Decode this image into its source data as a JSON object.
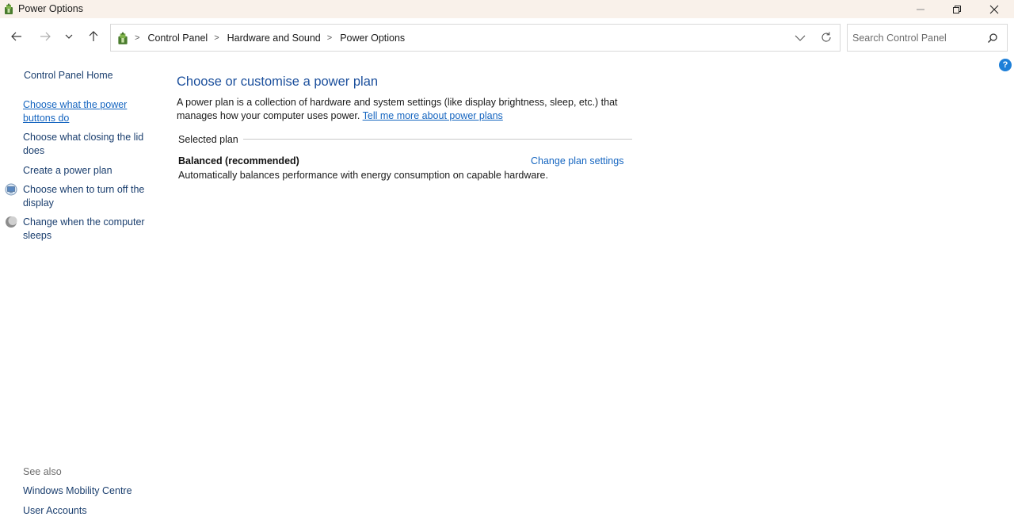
{
  "window": {
    "title": "Power Options",
    "app_icon": "power-options-icon"
  },
  "nav": {
    "back_icon": "back-arrow-icon",
    "forward_icon": "forward-arrow-icon",
    "recent_icon": "chevron-down-icon",
    "up_icon": "up-arrow-icon"
  },
  "address": {
    "crumbs": [
      "Control Panel",
      "Hardware and Sound",
      "Power Options"
    ]
  },
  "search": {
    "placeholder": "Search Control Panel"
  },
  "sidebar": {
    "home": "Control Panel Home",
    "links": [
      {
        "label": "Choose what the power buttons do"
      },
      {
        "label": "Choose what closing the lid does"
      },
      {
        "label": "Create a power plan"
      },
      {
        "label": "Choose when to turn off the display",
        "icon": "display-icon"
      },
      {
        "label": "Change when the computer sleeps",
        "icon": "sleep-moon-icon"
      }
    ],
    "see_also": {
      "heading": "See also",
      "links": [
        "Windows Mobility Centre",
        "User Accounts"
      ]
    }
  },
  "main": {
    "title": "Choose or customise a power plan",
    "description": "A power plan is a collection of hardware and system settings (like display brightness, sleep, etc.) that manages how your computer uses power.",
    "learn_more": "Tell me more about power plans",
    "section_label": "Selected plan",
    "plan": {
      "name": "Balanced (recommended)",
      "change_label": "Change plan settings",
      "description": "Automatically balances performance with energy consumption on capable hardware."
    }
  },
  "colors": {
    "titlebar_bg": "#f9f1ea",
    "heading": "#1b4f9c",
    "link": "#1565c0",
    "sidebar_link": "#1a3e6e"
  }
}
